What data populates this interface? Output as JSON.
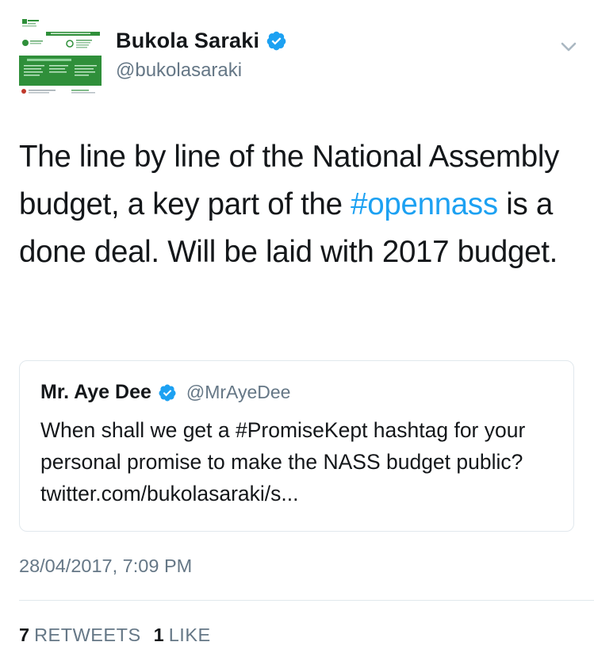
{
  "tweet": {
    "author": {
      "display_name": "Bukola Saraki",
      "handle": "@bukolasaraki",
      "verified": true
    },
    "text_parts": [
      "The line by line of the National Assembly budget, a key part of the ",
      "#opennass",
      " is a done deal. Will be laid with 2017 budget."
    ],
    "quoted": {
      "display_name": "Mr. Aye Dee",
      "handle": "@MrAyeDee",
      "verified": true,
      "text": "When shall we get a #PromiseKept hashtag for your personal promise to make the NASS budget public? twitter.com/bukolasaraki/s..."
    },
    "timestamp": "28/04/2017, 7:09 PM",
    "stats": {
      "retweets_count": "7",
      "retweets_label": "RETWEETS",
      "likes_count": "1",
      "likes_label": "LIKE"
    }
  },
  "colors": {
    "link": "#1da1f2",
    "text": "#14171a",
    "secondary": "#657786",
    "border": "#e1e8ed",
    "avatar_green": "#2f8f3a"
  },
  "icons": {
    "verified": "verified-badge-icon",
    "menu": "chevron-down-icon"
  }
}
